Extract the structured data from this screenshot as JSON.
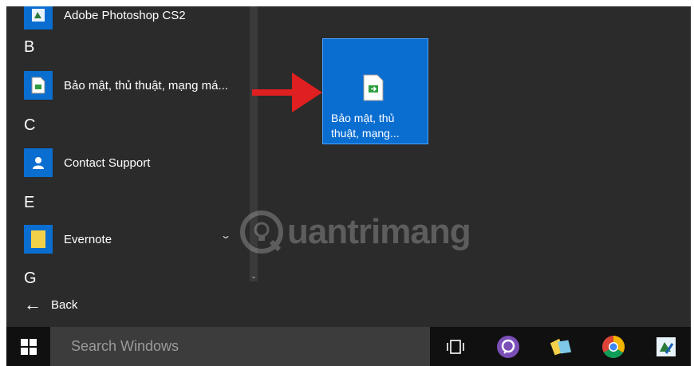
{
  "applist": {
    "items": [
      {
        "label": "Adobe Photoshop CS2",
        "icon": "photoshop-icon"
      },
      {
        "label": "Bảo mật, thủ thuật, mạng má...",
        "icon": "document-shortcut-icon"
      },
      {
        "label": "Contact Support",
        "icon": "person-icon"
      },
      {
        "label": "Evernote",
        "icon": "folder-icon"
      }
    ],
    "letters": [
      "B",
      "C",
      "E",
      "G"
    ],
    "back_label": "Back"
  },
  "tile": {
    "label_line1": "Bảo mật, thủ",
    "label_line2": "thuật, mạng..."
  },
  "watermark": {
    "text": "uantrimang"
  },
  "taskbar": {
    "search_placeholder": "Search Windows",
    "icons": [
      "task-view-icon",
      "viber-icon",
      "file-manager-icon",
      "chrome-icon",
      "app-icon"
    ]
  },
  "colors": {
    "accent": "#0a6ed1",
    "background": "#2b2b2b",
    "taskbar": "#101010",
    "arrow": "#e02020"
  }
}
